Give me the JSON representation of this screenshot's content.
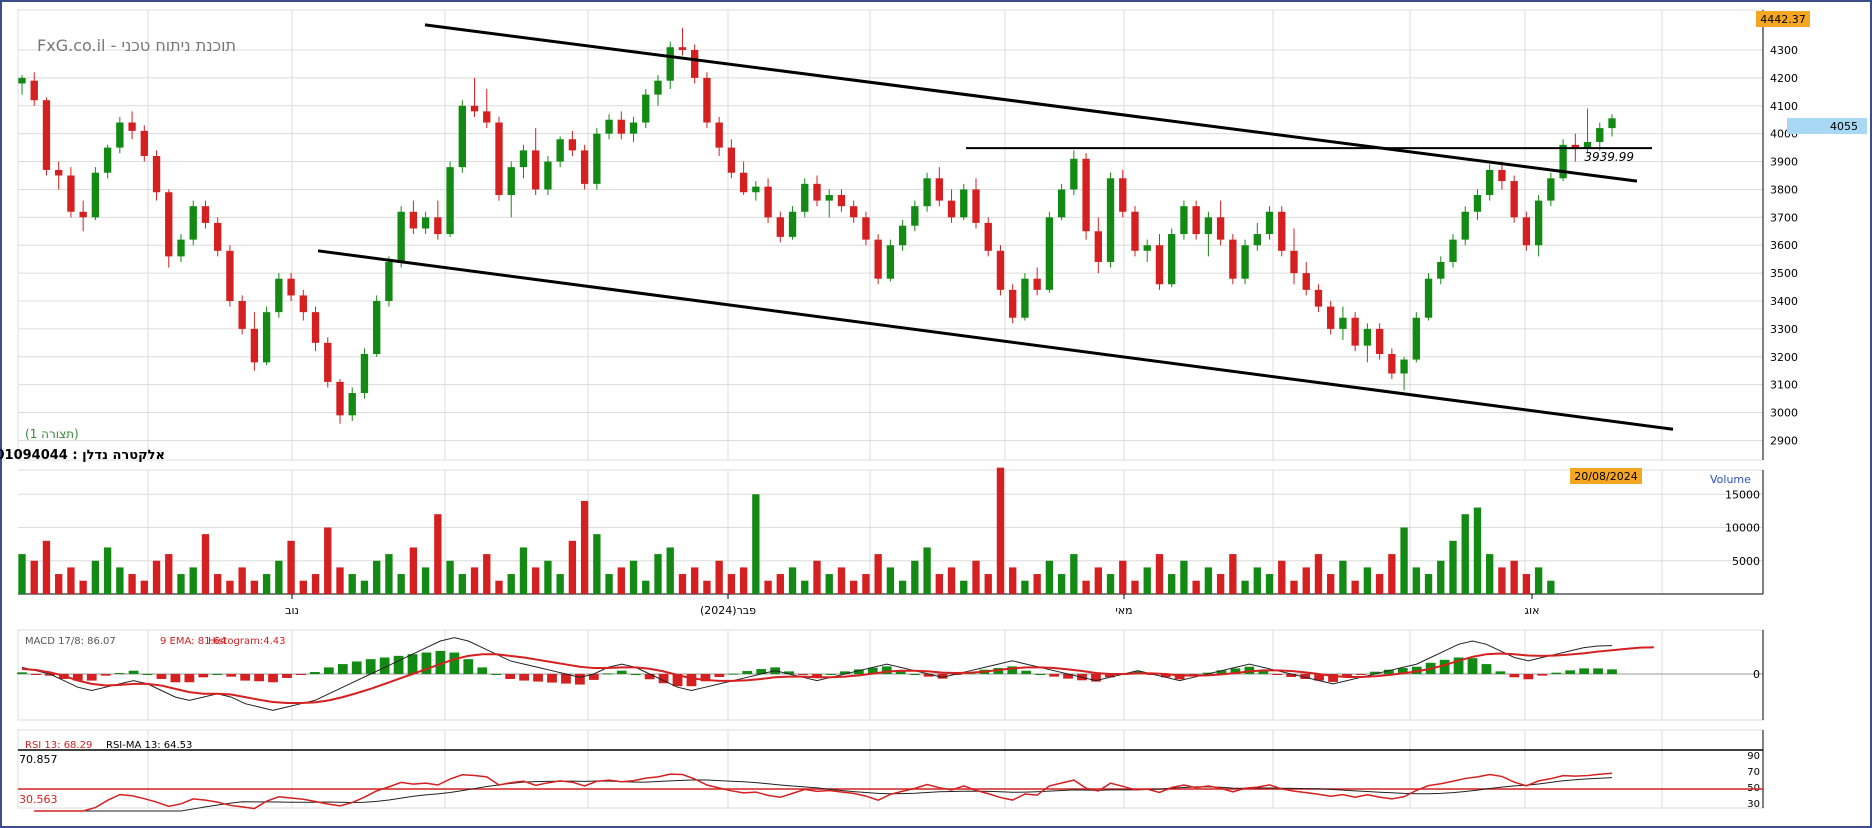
{
  "brand_title": "FxG.co.il - תוכנת ניתוח טכני",
  "instrument": "אלקטרה נדלן : 01094044",
  "pattern_label": "(תצורה 1)",
  "colors": {
    "up": "#138a13",
    "down": "#d42020",
    "frame": "#3a4f8a",
    "grid": "#dcdcdc",
    "axis": "#000000",
    "badge_orange": "#f5a623",
    "badge_blue": "#a9d8f5"
  },
  "price_panel": {
    "y_ticks": [
      "4300",
      "4200",
      "4100",
      "4000",
      "3900",
      "3800",
      "3700",
      "3600",
      "3500",
      "3400",
      "3300",
      "3200",
      "3100",
      "3000",
      "2900"
    ],
    "high_badge": "4442.37",
    "last_price_badge": "4055",
    "level_label": "3939.99"
  },
  "volume_panel": {
    "title": "Volume",
    "date_badge": "20/08/2024",
    "y_ticks": [
      "15000",
      "10000",
      "5000"
    ]
  },
  "x_axis": {
    "labels": [
      "נוב",
      "פבר(2024)",
      "מאי",
      "אוג"
    ]
  },
  "macd_panel": {
    "label_macd": "MACD 17/8: 86.07",
    "label_ema": "9 EMA: 81.64",
    "label_hist": "Histogram:4.43",
    "y_ticks": [
      "0"
    ]
  },
  "rsi_panel": {
    "label_rsi": "RSI 13: 68.29",
    "label_rsima": "RSI-MA 13: 64.53",
    "upper_level": "70.857",
    "lower_level": "30.563",
    "y_ticks": [
      "90",
      "70",
      "50",
      "30"
    ]
  },
  "chart_data": {
    "type": "candlestick",
    "note_series": "approximate daily OHLC read from chart, chronological",
    "ohlc": [
      [
        4180,
        4210,
        4140,
        4200
      ],
      [
        4190,
        4220,
        4100,
        4120
      ],
      [
        4120,
        4130,
        3850,
        3870
      ],
      [
        3870,
        3900,
        3800,
        3850
      ],
      [
        3850,
        3880,
        3700,
        3720
      ],
      [
        3720,
        3760,
        3650,
        3700
      ],
      [
        3700,
        3880,
        3690,
        3860
      ],
      [
        3860,
        3960,
        3840,
        3950
      ],
      [
        3950,
        4060,
        3930,
        4040
      ],
      [
        4040,
        4080,
        3980,
        4010
      ],
      [
        4010,
        4030,
        3900,
        3920
      ],
      [
        3920,
        3940,
        3760,
        3790
      ],
      [
        3790,
        3800,
        3520,
        3560
      ],
      [
        3560,
        3640,
        3540,
        3620
      ],
      [
        3620,
        3760,
        3600,
        3740
      ],
      [
        3740,
        3760,
        3660,
        3680
      ],
      [
        3680,
        3700,
        3560,
        3580
      ],
      [
        3580,
        3600,
        3380,
        3400
      ],
      [
        3400,
        3420,
        3280,
        3300
      ],
      [
        3300,
        3360,
        3150,
        3180
      ],
      [
        3180,
        3380,
        3170,
        3360
      ],
      [
        3360,
        3500,
        3340,
        3480
      ],
      [
        3480,
        3500,
        3400,
        3420
      ],
      [
        3420,
        3440,
        3330,
        3360
      ],
      [
        3360,
        3380,
        3220,
        3250
      ],
      [
        3250,
        3270,
        3090,
        3110
      ],
      [
        3110,
        3120,
        2960,
        2990
      ],
      [
        2990,
        3090,
        2970,
        3070
      ],
      [
        3070,
        3230,
        3050,
        3210
      ],
      [
        3210,
        3420,
        3200,
        3400
      ],
      [
        3400,
        3560,
        3380,
        3540
      ],
      [
        3540,
        3740,
        3520,
        3720
      ],
      [
        3720,
        3760,
        3640,
        3660
      ],
      [
        3660,
        3720,
        3640,
        3700
      ],
      [
        3700,
        3760,
        3620,
        3640
      ],
      [
        3640,
        3900,
        3630,
        3880
      ],
      [
        3880,
        4120,
        3860,
        4100
      ],
      [
        4100,
        4200,
        4060,
        4080
      ],
      [
        4080,
        4160,
        4020,
        4040
      ],
      [
        4040,
        4060,
        3760,
        3780
      ],
      [
        3780,
        3900,
        3700,
        3880
      ],
      [
        3880,
        3960,
        3840,
        3940
      ],
      [
        3940,
        4020,
        3780,
        3800
      ],
      [
        3800,
        3920,
        3780,
        3900
      ],
      [
        3900,
        3990,
        3880,
        3980
      ],
      [
        3980,
        4010,
        3920,
        3940
      ],
      [
        3940,
        3960,
        3800,
        3820
      ],
      [
        3820,
        4020,
        3800,
        4000
      ],
      [
        4000,
        4070,
        3980,
        4050
      ],
      [
        4050,
        4080,
        3980,
        4000
      ],
      [
        4000,
        4060,
        3970,
        4040
      ],
      [
        4040,
        4160,
        4020,
        4140
      ],
      [
        4140,
        4210,
        4100,
        4190
      ],
      [
        4190,
        4330,
        4160,
        4310
      ],
      [
        4310,
        4380,
        4280,
        4300
      ],
      [
        4300,
        4320,
        4180,
        4200
      ],
      [
        4200,
        4220,
        4020,
        4040
      ],
      [
        4040,
        4060,
        3920,
        3950
      ],
      [
        3950,
        3980,
        3840,
        3860
      ],
      [
        3860,
        3900,
        3780,
        3790
      ],
      [
        3790,
        3830,
        3760,
        3810
      ],
      [
        3810,
        3840,
        3680,
        3700
      ],
      [
        3700,
        3720,
        3610,
        3630
      ],
      [
        3630,
        3740,
        3620,
        3720
      ],
      [
        3720,
        3840,
        3700,
        3820
      ],
      [
        3820,
        3850,
        3740,
        3760
      ],
      [
        3760,
        3800,
        3700,
        3780
      ],
      [
        3780,
        3800,
        3720,
        3740
      ],
      [
        3740,
        3760,
        3680,
        3700
      ],
      [
        3700,
        3720,
        3600,
        3620
      ],
      [
        3620,
        3640,
        3460,
        3480
      ],
      [
        3480,
        3620,
        3470,
        3600
      ],
      [
        3600,
        3690,
        3580,
        3670
      ],
      [
        3670,
        3760,
        3650,
        3740
      ],
      [
        3740,
        3860,
        3720,
        3840
      ],
      [
        3840,
        3880,
        3740,
        3760
      ],
      [
        3760,
        3800,
        3680,
        3700
      ],
      [
        3700,
        3820,
        3690,
        3800
      ],
      [
        3800,
        3840,
        3660,
        3680
      ],
      [
        3680,
        3700,
        3560,
        3580
      ],
      [
        3580,
        3600,
        3420,
        3440
      ],
      [
        3440,
        3460,
        3320,
        3340
      ],
      [
        3340,
        3500,
        3330,
        3480
      ],
      [
        3480,
        3520,
        3420,
        3440
      ],
      [
        3440,
        3720,
        3430,
        3700
      ],
      [
        3700,
        3820,
        3690,
        3800
      ],
      [
        3800,
        3940,
        3780,
        3910
      ],
      [
        3910,
        3930,
        3620,
        3650
      ],
      [
        3650,
        3700,
        3500,
        3540
      ],
      [
        3540,
        3860,
        3520,
        3840
      ],
      [
        3840,
        3870,
        3700,
        3720
      ],
      [
        3720,
        3740,
        3560,
        3580
      ],
      [
        3580,
        3620,
        3540,
        3600
      ],
      [
        3600,
        3640,
        3440,
        3460
      ],
      [
        3460,
        3660,
        3450,
        3640
      ],
      [
        3640,
        3760,
        3620,
        3740
      ],
      [
        3740,
        3760,
        3620,
        3640
      ],
      [
        3640,
        3720,
        3560,
        3700
      ],
      [
        3700,
        3760,
        3600,
        3620
      ],
      [
        3620,
        3640,
        3460,
        3480
      ],
      [
        3480,
        3620,
        3460,
        3600
      ],
      [
        3600,
        3680,
        3580,
        3640
      ],
      [
        3640,
        3740,
        3620,
        3720
      ],
      [
        3720,
        3740,
        3560,
        3580
      ],
      [
        3580,
        3660,
        3460,
        3500
      ],
      [
        3500,
        3540,
        3420,
        3440
      ],
      [
        3440,
        3460,
        3360,
        3380
      ],
      [
        3380,
        3400,
        3280,
        3300
      ],
      [
        3300,
        3380,
        3260,
        3340
      ],
      [
        3340,
        3360,
        3220,
        3240
      ],
      [
        3240,
        3320,
        3180,
        3300
      ],
      [
        3300,
        3320,
        3190,
        3210
      ],
      [
        3210,
        3230,
        3120,
        3140
      ],
      [
        3140,
        3200,
        3080,
        3190
      ],
      [
        3190,
        3360,
        3180,
        3340
      ],
      [
        3340,
        3500,
        3330,
        3480
      ],
      [
        3480,
        3560,
        3460,
        3540
      ],
      [
        3540,
        3640,
        3520,
        3620
      ],
      [
        3620,
        3740,
        3600,
        3720
      ],
      [
        3720,
        3800,
        3690,
        3780
      ],
      [
        3780,
        3890,
        3760,
        3870
      ],
      [
        3870,
        3900,
        3800,
        3830
      ],
      [
        3830,
        3850,
        3680,
        3700
      ],
      [
        3700,
        3720,
        3580,
        3600
      ],
      [
        3600,
        3780,
        3560,
        3760
      ],
      [
        3760,
        3860,
        3740,
        3840
      ],
      [
        3840,
        3980,
        3830,
        3960
      ],
      [
        3960,
        4000,
        3900,
        3950
      ],
      [
        3950,
        4090,
        3930,
        3970
      ],
      [
        3970,
        4040,
        3940,
        4020
      ],
      [
        4020,
        4070,
        3990,
        4055
      ]
    ],
    "volume": [
      6,
      5,
      8,
      3,
      4,
      2,
      5,
      7,
      4,
      3,
      2,
      5,
      6,
      3,
      4,
      9,
      3,
      2,
      4,
      2,
      3,
      5,
      8,
      2,
      3,
      10,
      4,
      3,
      2,
      5,
      6,
      3,
      7,
      4,
      12,
      5,
      3,
      4,
      6,
      2,
      3,
      7,
      4,
      5,
      3,
      8,
      14,
      9,
      3,
      4,
      5,
      2,
      6,
      7,
      3,
      4,
      2,
      5,
      3,
      4,
      15,
      2,
      3,
      4,
      2,
      5,
      3,
      4,
      2,
      3,
      6,
      4,
      2,
      5,
      7,
      3,
      4,
      2,
      5,
      3,
      19,
      4,
      2,
      3,
      5,
      3,
      6,
      2,
      4,
      3,
      5,
      2,
      4,
      6,
      3,
      5,
      2,
      4,
      3,
      6,
      2,
      4,
      3,
      5,
      2,
      4,
      6,
      3,
      5,
      2,
      4,
      3,
      6,
      10,
      4,
      3,
      5,
      8,
      12,
      13,
      6,
      4,
      5,
      3,
      4,
      2
    ],
    "volume_unit": "thousands",
    "macd": [
      20,
      10,
      0,
      -20,
      -40,
      -50,
      -40,
      -30,
      -20,
      -30,
      -50,
      -70,
      -80,
      -70,
      -60,
      -70,
      -90,
      -100,
      -110,
      -100,
      -90,
      -80,
      -60,
      -40,
      -20,
      0,
      20,
      40,
      60,
      80,
      100,
      110,
      100,
      80,
      60,
      40,
      30,
      20,
      10,
      0,
      -10,
      0,
      20,
      30,
      20,
      0,
      -20,
      -40,
      -50,
      -40,
      -30,
      -20,
      -10,
      0,
      10,
      0,
      -10,
      -20,
      -10,
      0,
      10,
      20,
      30,
      20,
      10,
      0,
      -10,
      0,
      10,
      20,
      30,
      40,
      30,
      20,
      10,
      0,
      -10,
      -20,
      -10,
      0,
      10,
      0,
      -10,
      -20,
      -10,
      0,
      10,
      20,
      30,
      20,
      10,
      0,
      -10,
      -20,
      -30,
      -20,
      -10,
      0,
      10,
      20,
      30,
      50,
      70,
      90,
      100,
      90,
      70,
      50,
      40,
      50,
      60,
      70,
      80,
      85,
      86
    ],
    "macd_ema": [
      15,
      12,
      5,
      -5,
      -20,
      -30,
      -35,
      -33,
      -30,
      -30,
      -35,
      -45,
      -55,
      -60,
      -60,
      -62,
      -70,
      -78,
      -85,
      -88,
      -88,
      -86,
      -80,
      -70,
      -58,
      -45,
      -30,
      -15,
      0,
      15,
      30,
      45,
      55,
      60,
      60,
      55,
      50,
      43,
      36,
      29,
      22,
      18,
      18,
      20,
      20,
      16,
      8,
      -3,
      -13,
      -18,
      -21,
      -21,
      -19,
      -15,
      -10,
      -8,
      -8,
      -10,
      -10,
      -8,
      -4,
      1,
      7,
      10,
      10,
      8,
      4,
      3,
      4,
      7,
      12,
      17,
      20,
      20,
      18,
      14,
      9,
      3,
      0,
      0,
      2,
      2,
      0,
      -4,
      -5,
      -4,
      -1,
      3,
      8,
      11,
      11,
      9,
      5,
      0,
      -6,
      -9,
      -9,
      -7,
      -3,
      2,
      8,
      16,
      27,
      40,
      52,
      60,
      62,
      60,
      56,
      55,
      56,
      59,
      63,
      68,
      72,
      76,
      80,
      81
    ]
  }
}
